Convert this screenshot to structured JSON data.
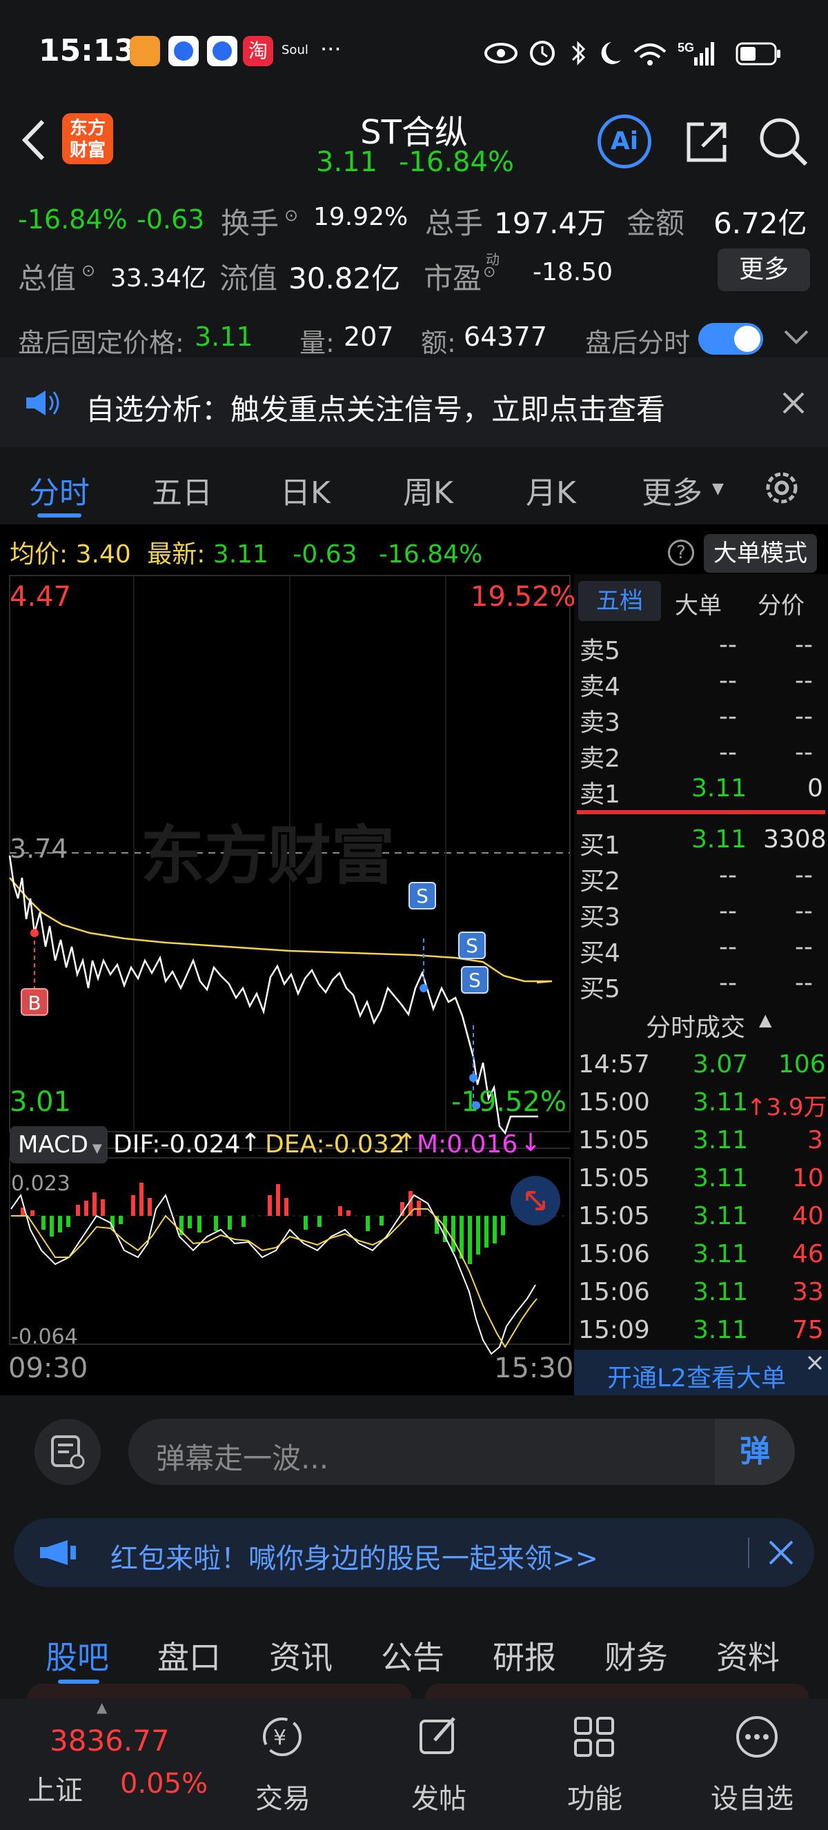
{
  "status": {
    "time": "15:13",
    "app_badges": [
      "淘",
      "Soul",
      "···"
    ],
    "network": "5G"
  },
  "header": {
    "title": "ST合纵",
    "price": "3.11",
    "change_pct": "-16.84%",
    "ai_label": "Ai"
  },
  "quote": {
    "chg_pct": "-16.84%",
    "chg": "-0.63",
    "turnover_label": "换手",
    "turnover": "19.92%",
    "volume_label": "总手",
    "volume": "197.4万",
    "amount_label": "金额",
    "amount": "6.72亿",
    "mktcap_label": "总值",
    "mktcap": "33.34亿",
    "float_label": "流值",
    "float_val": "30.82亿",
    "pe_label": "市盈",
    "pe_sup": "动",
    "pe": "-18.50",
    "more_label": "更多",
    "after_label": "盘后固定价格:",
    "after_price": "3.11",
    "after_vol_label": "量:",
    "after_vol": "207",
    "after_amt_label": "额:",
    "after_amt": "64377",
    "after_toggle_label": "盘后分时"
  },
  "banner": {
    "text": "自选分析：触发重点关注信号，立即点击查看"
  },
  "tabs": [
    "分时",
    "五日",
    "日K",
    "周K",
    "月K",
    "更多"
  ],
  "info": {
    "avg_label": "均价:",
    "avg": "3.40",
    "latest_label": "最新:",
    "latest": "3.11",
    "chg": "-0.63",
    "chg_pct": "-16.84%",
    "big_order_label": "大单模式"
  },
  "axis": {
    "top_price": "4.47",
    "top_pct": "19.52%",
    "mid_price": "3.74",
    "bottom_price": "3.01",
    "bottom_pct": "-19.52%",
    "watermark": "东方财富",
    "time_start": "09:30",
    "time_end": "15:30"
  },
  "macd": {
    "label": "MACD",
    "dif": "DIF:-0.024",
    "dea": "DEA:-0.032",
    "m": "M:0.016",
    "top": "0.023",
    "bottom": "-0.064"
  },
  "markers": {
    "b": "B",
    "s": "S"
  },
  "orderbook": {
    "tabs": [
      "五档",
      "大单",
      "分价"
    ],
    "asks": [
      {
        "label": "卖5",
        "price": "--",
        "vol": "--"
      },
      {
        "label": "卖4",
        "price": "--",
        "vol": "--"
      },
      {
        "label": "卖3",
        "price": "--",
        "vol": "--"
      },
      {
        "label": "卖2",
        "price": "--",
        "vol": "--"
      },
      {
        "label": "卖1",
        "price": "3.11",
        "vol": "0"
      }
    ],
    "bids": [
      {
        "label": "买1",
        "price": "3.11",
        "vol": "3308"
      },
      {
        "label": "买2",
        "price": "--",
        "vol": "--"
      },
      {
        "label": "买3",
        "price": "--",
        "vol": "--"
      },
      {
        "label": "买4",
        "price": "--",
        "vol": "--"
      },
      {
        "label": "买5",
        "price": "--",
        "vol": "--"
      }
    ],
    "trades_header": "分时成交",
    "trades": [
      {
        "time": "14:57",
        "price": "3.07",
        "vol": "106"
      },
      {
        "time": "15:00",
        "price": "3.11",
        "vol": "↑3.9万"
      },
      {
        "time": "15:05",
        "price": "3.11",
        "vol": "3"
      },
      {
        "time": "15:05",
        "price": "3.11",
        "vol": "10"
      },
      {
        "time": "15:05",
        "price": "3.11",
        "vol": "40"
      },
      {
        "time": "15:06",
        "price": "3.11",
        "vol": "46"
      },
      {
        "time": "15:06",
        "price": "3.11",
        "vol": "33"
      },
      {
        "time": "15:09",
        "price": "3.11",
        "vol": "75"
      }
    ],
    "l2_label": "开通L2查看大单"
  },
  "danmu": {
    "placeholder": "弹幕走一波...",
    "send_label": "弹"
  },
  "redpacket": {
    "text": "红包来啦！喊你身边的股民一起来领>>"
  },
  "section_tabs": [
    "股吧",
    "盘口",
    "资讯",
    "公告",
    "研报",
    "财务",
    "资料"
  ],
  "index": {
    "value": "3836.77",
    "name": "上证",
    "chg": "0.05%"
  },
  "bottom_nav": [
    "交易",
    "发帖",
    "功能",
    "设自选"
  ],
  "colors": {
    "up": "#ff3b3b",
    "down": "#1fd01f",
    "avg_line": "#f5d34a",
    "accent": "#3a8cff",
    "bg": "#151618"
  }
}
